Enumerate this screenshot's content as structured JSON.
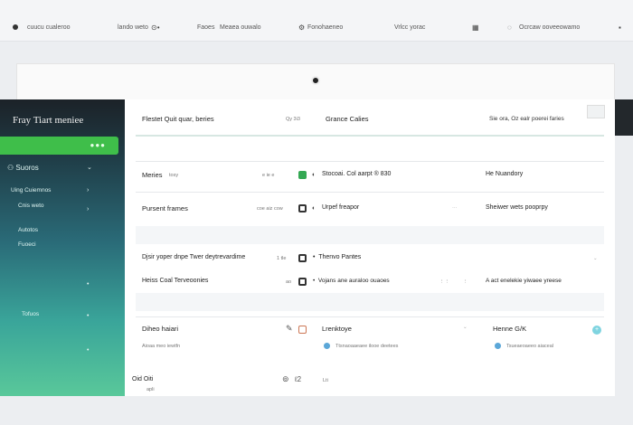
{
  "topbar": {
    "items": [
      "cuucu cualeroo",
      "lando weto",
      "Faoes",
      "Meaea ouwalo",
      "Fonohaeneo",
      "Vrlcc yorac",
      "Ocrcaw ooveeowamo"
    ]
  },
  "sidebar": {
    "title": "Fray Tiart meniee",
    "section": "Suoros",
    "items": [
      "Uing Cuiemnos",
      "Cnis weto",
      "Autotos",
      "Fuoeci",
      "Tofuos"
    ]
  },
  "content": {
    "header": {
      "col1": "Flestet Quit quar, beries",
      "col1_count": "Qy 3i3",
      "col2": "Grance Calies",
      "col3": "Sie ora, Oz ealr poerei faries"
    },
    "rows": [
      {
        "title": "Meries",
        "sub": "tosy",
        "meta": "e ie e",
        "mid": "Stocoai. Col aarpt ® 830",
        "right": "He Nuandory"
      },
      {
        "title": "Pursent frames",
        "meta": "coe aiz cow",
        "mid": "Urpef freapor",
        "right": "Sheiwer wets pooprpy"
      },
      {
        "title": "Djsir yoper dnpe Twer deytrevardime",
        "meta": "1 tle",
        "mid": "Thenvo Pantes"
      },
      {
        "title": "Heiss Coal Terveoonies",
        "meta": "ao",
        "mid": "Vojans ane auraloo ouaoes",
        "right": "A act enelekie yiwaee yreese"
      }
    ],
    "bottom": {
      "col1_title": "Diheo haiari",
      "col1_sub": "Aioaa meo iewtfn",
      "col2_title": "Lrenktoye",
      "col2_sub": "Ttsnaoaaeaee ilooe deetees",
      "col3_title": "Henne G/K",
      "col3_sub": "Tsueaeoaeeo aiaceal"
    },
    "footer": {
      "left": "Oid Oiti",
      "mid": "Lti",
      "left_sub": "apli"
    }
  }
}
